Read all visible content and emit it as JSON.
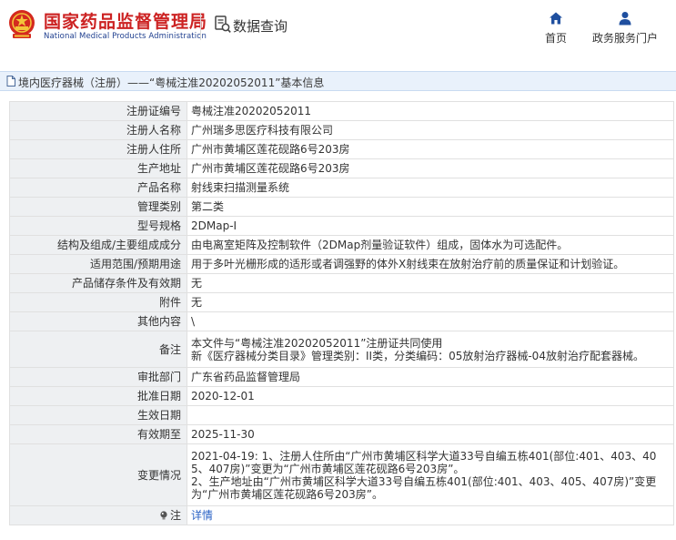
{
  "header": {
    "logo_cn": "国家药品监督管理局",
    "logo_en": "National Medical Products Administration",
    "query_label": "数据查询",
    "nav": [
      {
        "label": "首页",
        "icon": "home-icon"
      },
      {
        "label": "政务服务门户",
        "icon": "user-icon"
      }
    ]
  },
  "breadcrumb": {
    "text": "境内医疗器械（注册）——“粤械注准20202052011”基本信息",
    "icon": "document-icon"
  },
  "rows": [
    {
      "label": "注册证编号",
      "value": "粤械注准20202052011"
    },
    {
      "label": "注册人名称",
      "value": "广州瑞多思医疗科技有限公司"
    },
    {
      "label": "注册人住所",
      "value": "广州市黄埔区莲花砚路6号203房"
    },
    {
      "label": "生产地址",
      "value": "广州市黄埔区莲花砚路6号203房"
    },
    {
      "label": "产品名称",
      "value": "射线束扫描测量系统"
    },
    {
      "label": "管理类别",
      "value": "第二类"
    },
    {
      "label": "型号规格",
      "value": "2DMap-I"
    },
    {
      "label": "结构及组成/主要组成成分",
      "value": "由电离室矩阵及控制软件（2DMap剂量验证软件）组成，固体水为可选配件。"
    },
    {
      "label": "适用范围/预期用途",
      "value": "用于多叶光栅形成的适形或者调强野的体外X射线束在放射治疗前的质量保证和计划验证。"
    },
    {
      "label": "产品储存条件及有效期",
      "value": "无"
    },
    {
      "label": "附件",
      "value": "无"
    },
    {
      "label": "其他内容",
      "value": "\\"
    },
    {
      "label": "备注",
      "lines": [
        "本文件与“粤械注准20202052011”注册证共同使用",
        "新《医疗器械分类目录》管理类别：II类，分类编码：05放射治疗器械-04放射治疗配套器械。"
      ]
    },
    {
      "label": "审批部门",
      "value": "广东省药品监督管理局"
    },
    {
      "label": "批准日期",
      "value": "2020-12-01"
    },
    {
      "label": "生效日期",
      "value": ""
    },
    {
      "label": "有效期至",
      "value": "2025-11-30"
    },
    {
      "label": "变更情况",
      "lines": [
        "2021-04-19: 1、注册人住所由“广州市黄埔区科学大道33号自编五栋401(部位:401、403、40",
        "5、407房)”变更为“广州市黄埔区莲花砚路6号203房”。",
        "2、生产地址由“广州市黄埔区科学大道33号自编五栋401(部位:401、403、405、407房)”变更",
        "为“广州市黄埔区莲花砚路6号203房”。"
      ]
    },
    {
      "label": "注",
      "value": "详情",
      "icon": "bulb-icon"
    }
  ]
}
